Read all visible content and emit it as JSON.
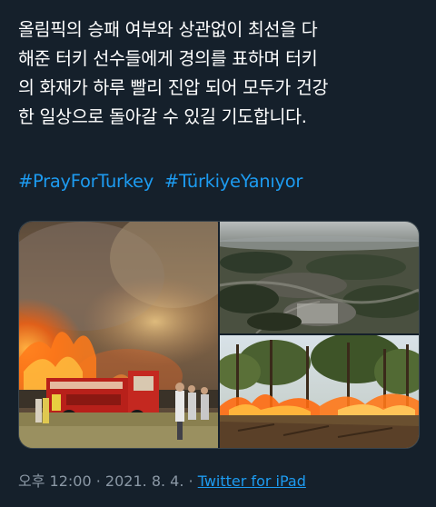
{
  "tweet": {
    "lines": [
      "올림픽의 승패 여부와 상관없이 최선을 다",
      "해준 터키 선수들에게 경의를 표하며 터키",
      "의 화재가 하루 빨리 진압 되어 모두가 건강",
      "한 일상으로 돌아갈 수 있길 기도합니다."
    ],
    "hashtags": [
      "#PrayForTurkey",
      "#TürkiyeYanıyor"
    ]
  },
  "meta": {
    "time": "오후 12:00",
    "separator": "·",
    "date": "2021. 8. 4.",
    "source": "Twitter for iPad"
  },
  "media": [
    {
      "name": "fire-truck-photo"
    },
    {
      "name": "burned-forest-aerial-photo"
    },
    {
      "name": "forest-fire-photo"
    }
  ],
  "colors": {
    "background": "#15202b",
    "text": "#ffffff",
    "link": "#1d9bf0",
    "muted": "#8b98a5"
  }
}
